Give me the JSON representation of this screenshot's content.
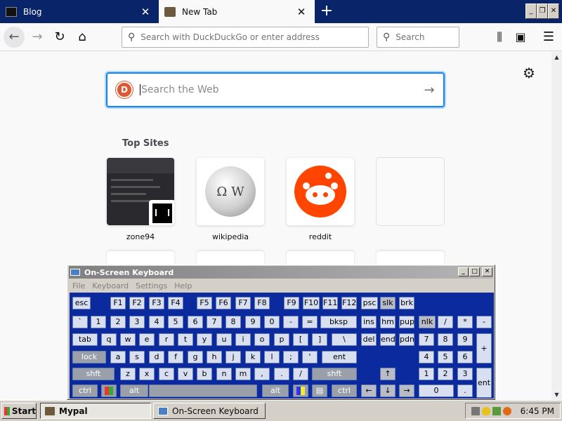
{
  "tabs": [
    {
      "title": "Blog",
      "close": "✕"
    },
    {
      "title": "New Tab",
      "close": "✕"
    }
  ],
  "new_tab": "+",
  "window_controls": {
    "minimize": "_",
    "restore": "❐",
    "close": "✕"
  },
  "toolbar": {
    "back": "←",
    "forward": "→",
    "reload": "↻",
    "home": "⌂",
    "address_placeholder": "Search with DuckDuckGo or enter address",
    "search_placeholder": "Search",
    "library": "⫼",
    "sidebar": "▣",
    "menu": "☰"
  },
  "newtab_page": {
    "search_placeholder": "Search the Web",
    "ddg_icon": "D",
    "go": "→",
    "settings": "⚙",
    "top_sites_title": "Top Sites",
    "sites": [
      {
        "name": "zone94"
      },
      {
        "name": "wikipedia"
      },
      {
        "name": "reddit"
      },
      {
        "name": ""
      }
    ],
    "wiki_glyph": "Ω W"
  },
  "osk": {
    "title": "On-Screen Keyboard",
    "menu": [
      "File",
      "Keyboard",
      "Settings",
      "Help"
    ],
    "rows": [
      [
        "esc",
        "F1",
        "F2",
        "F3",
        "F4",
        "F5",
        "F6",
        "F7",
        "F8",
        "F9",
        "F10",
        "F11",
        "F12",
        "psc",
        "slk",
        "brk"
      ],
      [
        "`",
        "1",
        "2",
        "3",
        "4",
        "5",
        "6",
        "7",
        "8",
        "9",
        "0",
        "-",
        "=",
        "bksp",
        "ins",
        "hm",
        "pup",
        "nlk",
        "/",
        "*",
        "-"
      ],
      [
        "tab",
        "q",
        "w",
        "e",
        "r",
        "t",
        "y",
        "u",
        "i",
        "o",
        "p",
        "[",
        "]",
        "\\",
        "del",
        "end",
        "pdn",
        "7",
        "8",
        "9",
        "+"
      ],
      [
        "lock",
        "a",
        "s",
        "d",
        "f",
        "g",
        "h",
        "j",
        "k",
        "l",
        ";",
        "'",
        "ent",
        "4",
        "5",
        "6"
      ],
      [
        "shft",
        "z",
        "x",
        "c",
        "v",
        "b",
        "n",
        "m",
        ",",
        ".",
        "/",
        "shft",
        "↑",
        "1",
        "2",
        "3",
        "ent"
      ],
      [
        "ctrl",
        "",
        "alt",
        "",
        "alt",
        "",
        "",
        "ctrl",
        "←",
        "↓",
        "→",
        "0",
        "."
      ]
    ]
  },
  "taskbar": {
    "start": "Start",
    "tasks": [
      "Mypal",
      "On-Screen Keyboard"
    ],
    "clock": "6:45 PM"
  }
}
